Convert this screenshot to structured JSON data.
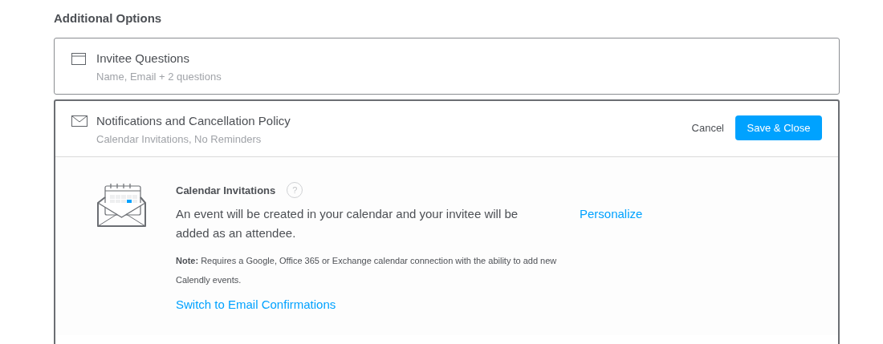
{
  "heading": "Additional Options",
  "sections": [
    {
      "kind": "questions",
      "title": "Invitee Questions",
      "summary": "Name, Email + 2 questions",
      "expanded": false
    },
    {
      "kind": "notifications",
      "title": "Notifications and Cancellation Policy",
      "summary": "Calendar Invitations, No Reminders",
      "expanded": true,
      "cancel": "Cancel",
      "save": "Save & Close",
      "detail": {
        "title": "Calendar Invitations",
        "help": "?",
        "description": "An event will be created in your calendar and your invitee will be added as an attendee.",
        "personalize": "Personalize",
        "note": "**Note:** Requires a Google, Office 365 or Exchange calendar connection with the ability to add new Calendly events.",
        "switch_link": "Switch to Email Confirmations"
      }
    }
  ]
}
